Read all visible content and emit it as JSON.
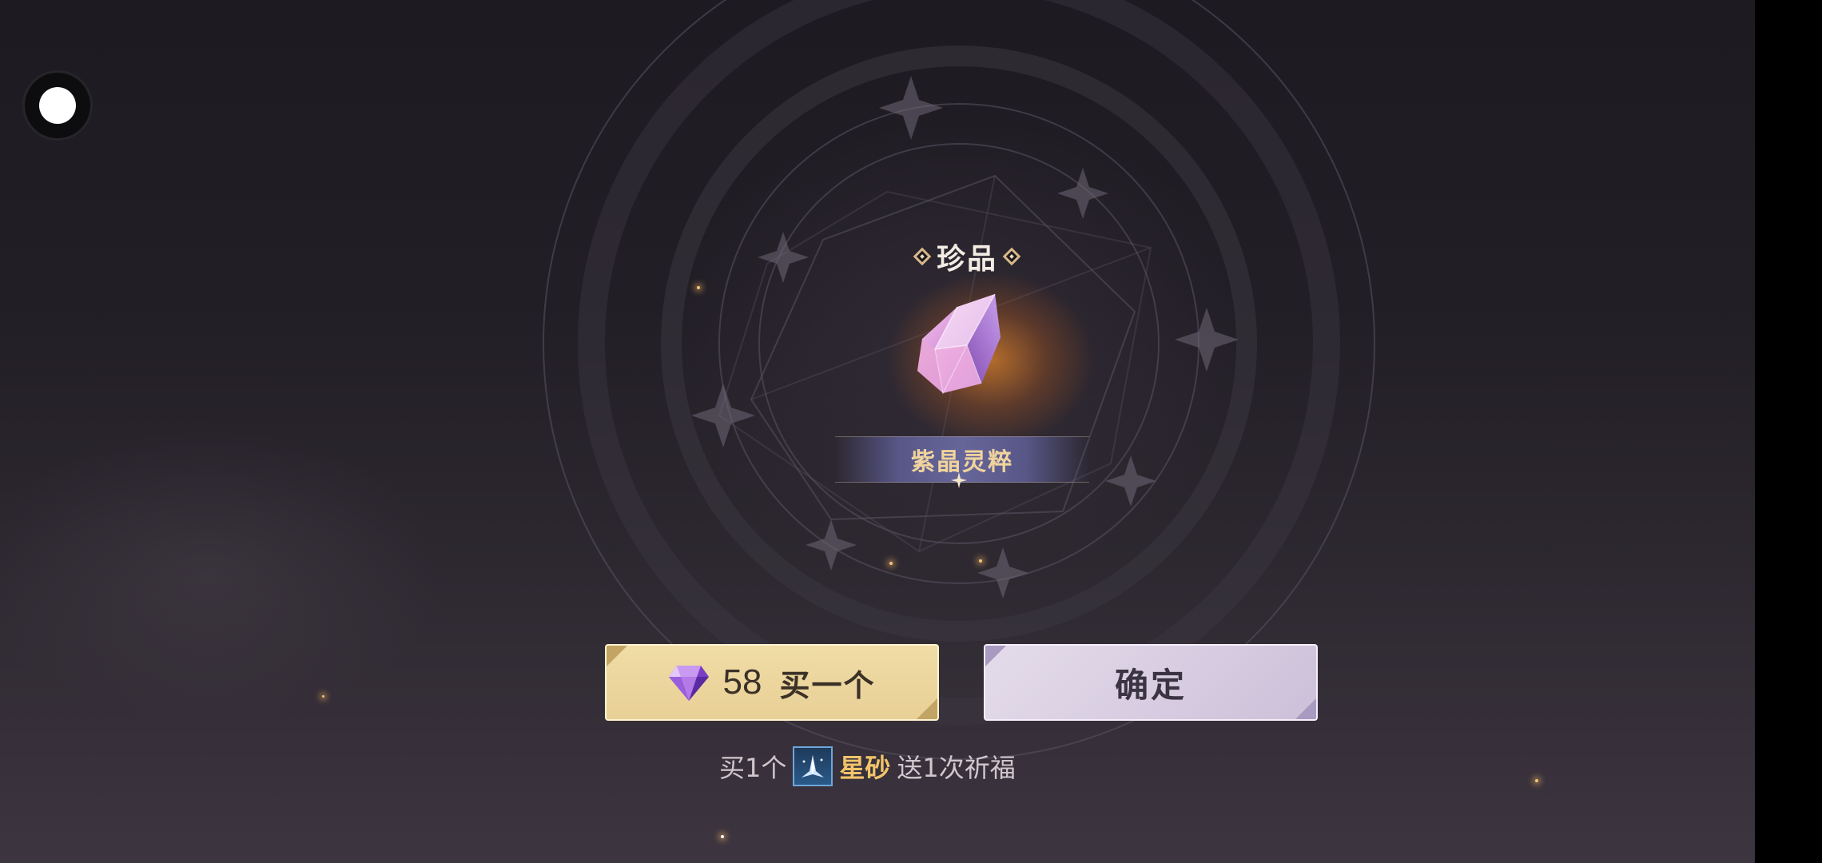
{
  "reward": {
    "rarity_label": "珍品",
    "item_name": "紫晶灵粹"
  },
  "buttons": {
    "buy": {
      "price": "58",
      "label": "买一个",
      "currency_icon": "purple-diamond-icon"
    },
    "confirm": {
      "label": "确定"
    }
  },
  "promo": {
    "prefix": "买1个",
    "item_icon": "stardust-icon",
    "item_name": "星砂",
    "suffix": "送1次祈福"
  },
  "colors": {
    "item_name": "#f0d39d",
    "buy_button": "#e8d096",
    "confirm_button": "#d6cbe0",
    "promo_item": "#f2c46b"
  }
}
